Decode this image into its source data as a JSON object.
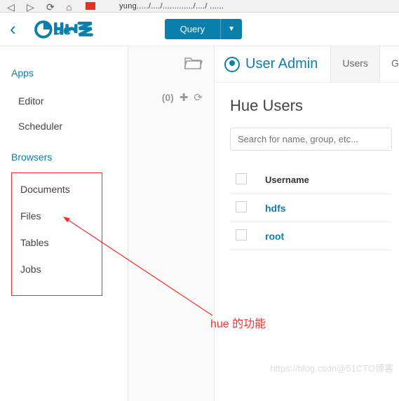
{
  "browser": {
    "url": "yung...../..../............./..../ ......"
  },
  "toolbar": {
    "query_label": "Query"
  },
  "sidebar": {
    "apps_header": "Apps",
    "apps": [
      "Editor",
      "Scheduler"
    ],
    "browsers_header": "Browsers",
    "browsers": [
      "Documents",
      "Files",
      "Tables",
      "Jobs"
    ]
  },
  "middle": {
    "count_label": "(0)"
  },
  "content": {
    "page_title": "User Admin",
    "tabs": [
      "Users",
      "Gro"
    ],
    "active_tab": 0,
    "section_title": "Hue Users",
    "search_placeholder": "Search for name, group, etc...",
    "table": {
      "header_username": "Username",
      "rows": [
        {
          "username": "hdfs"
        },
        {
          "username": "root"
        }
      ]
    }
  },
  "annotation": {
    "text": "hue 的功能"
  },
  "watermark": "https://blog.csdn@51CTO博客"
}
